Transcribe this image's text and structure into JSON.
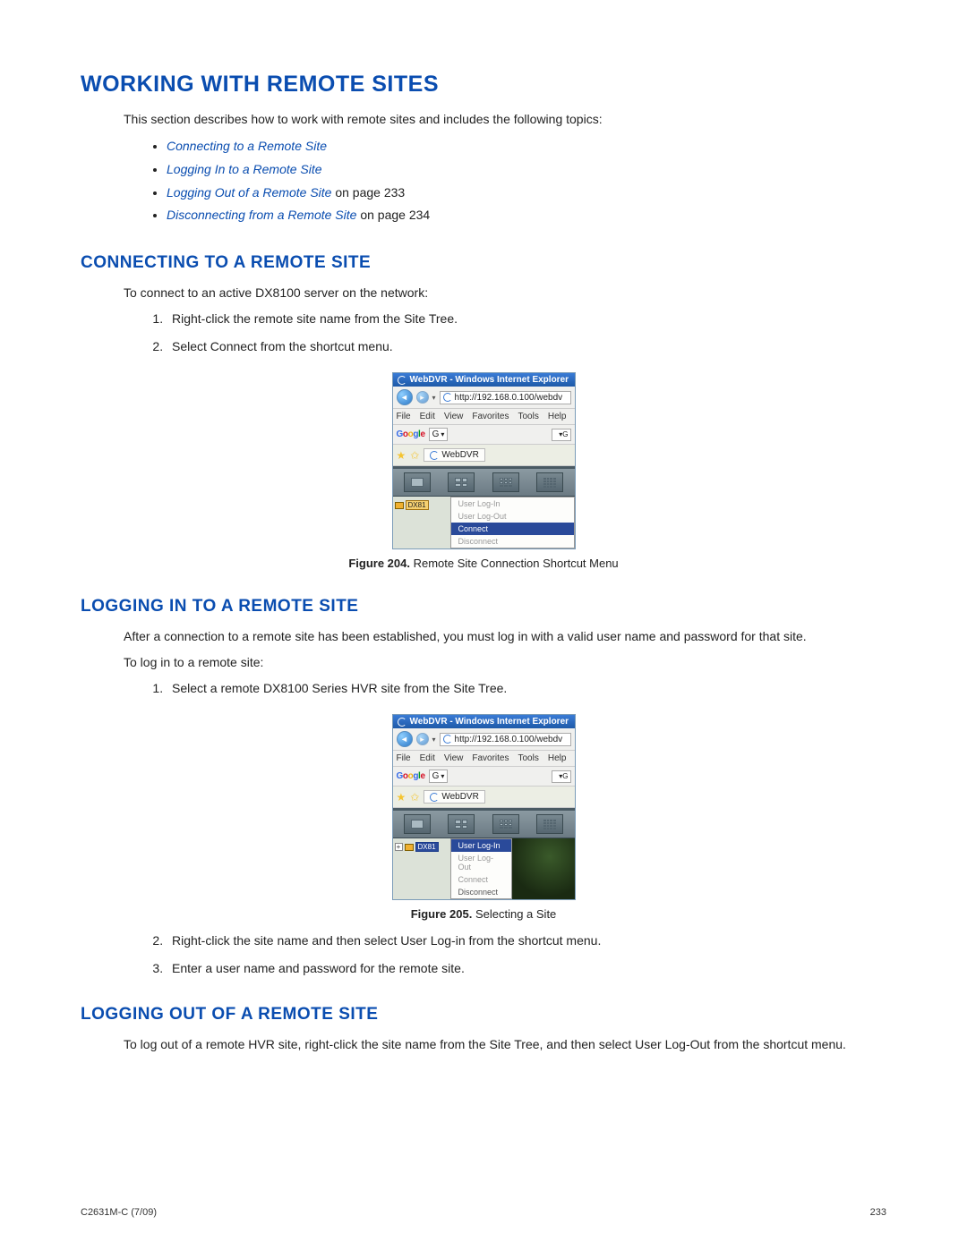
{
  "h1": "WORKING WITH REMOTE SITES",
  "intro": "This section describes how to work with remote sites and includes the following topics:",
  "toc": {
    "i1": "Connecting to a Remote Site",
    "i2": "Logging In to a Remote Site",
    "i3a": "Logging Out of a Remote Site",
    "i3b": " on page 233",
    "i4a": "Disconnecting from a Remote Site",
    "i4b": " on page 234"
  },
  "sec1": {
    "h": "CONNECTING TO A REMOTE SITE",
    "p": "To connect to an active DX8100 server on the network:",
    "s1": "Right-click the remote site name from the Site Tree.",
    "s2": "Select Connect from the shortcut menu."
  },
  "fig204": {
    "label": "Figure 204.",
    "cap": "Remote Site Connection Shortcut Menu"
  },
  "sec2": {
    "h": "LOGGING IN TO A REMOTE SITE",
    "p1": "After a connection to a remote site has been established, you must log in with a valid user name and password for that site.",
    "p2": "To log in to a remote site:",
    "s1": "Select a remote DX8100 Series HVR site from the Site Tree."
  },
  "fig205": {
    "label": "Figure 205.",
    "cap": "Selecting a Site"
  },
  "sec2b": {
    "s2": "Right-click the site name and then select User Log-in from the shortcut menu.",
    "s3": "Enter a user name and password for the remote site."
  },
  "sec3": {
    "h": "LOGGING OUT OF A REMOTE SITE",
    "p": "To log out of a remote HVR site, right-click the site name from the Site Tree, and then select User Log-Out from the shortcut menu."
  },
  "footer": {
    "left": "C2631M-C (7/09)",
    "right": "233"
  },
  "shot": {
    "title": "WebDVR - Windows Internet Explorer",
    "url": "http://192.168.0.100/webdv",
    "menus": {
      "file": "File",
      "edit": "Edit",
      "view": "View",
      "fav": "Favorites",
      "tools": "Tools",
      "help": "Help"
    },
    "google": "Google",
    "gbox": "G",
    "gend": "G",
    "tab": "WebDVR",
    "node": "DX81",
    "ctx": {
      "login": "User Log-In",
      "logout": "User Log-Out",
      "connect": "Connect",
      "disconnect": "Disconnect"
    },
    "plus": "+",
    "dropdown": "▾",
    "back": "◄",
    "fwd": "▸"
  }
}
